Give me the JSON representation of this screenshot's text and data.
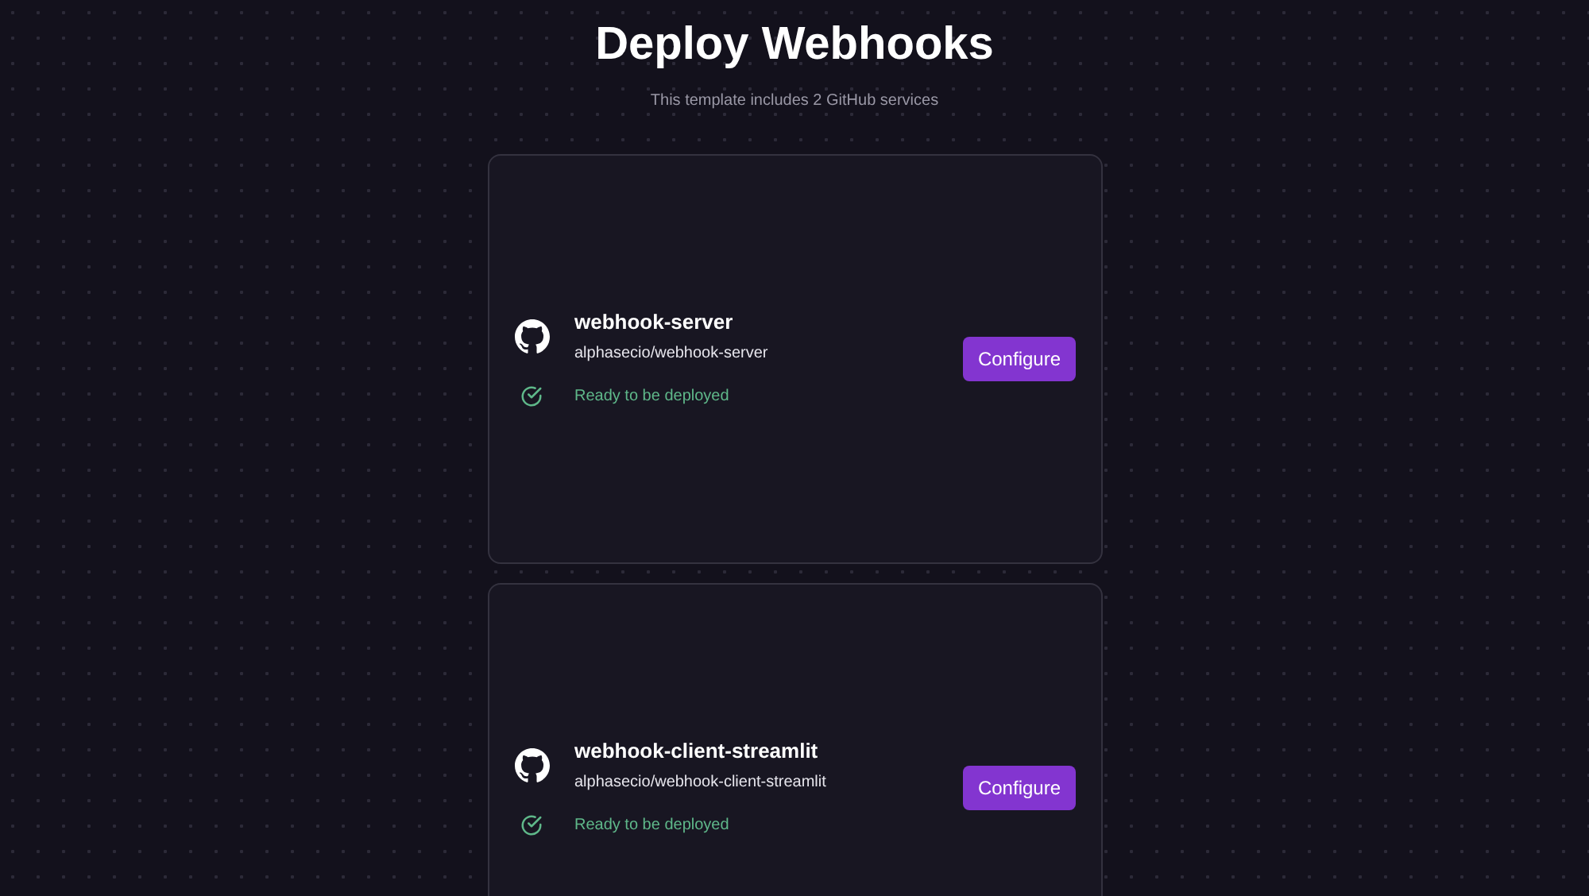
{
  "title": "Deploy Webhooks",
  "subtitle": "This template includes 2 GitHub services",
  "services": [
    {
      "name": "webhook-server",
      "repo": "alphasecio/webhook-server",
      "status": {
        "kind": "ready",
        "text": "Ready to be deployed"
      },
      "button": "Configure"
    },
    {
      "name": "webhook-client-streamlit",
      "repo": "alphasecio/webhook-client-streamlit",
      "status": {
        "kind": "ready",
        "text": "Ready to be deployed"
      },
      "button": "Configure"
    }
  ]
}
